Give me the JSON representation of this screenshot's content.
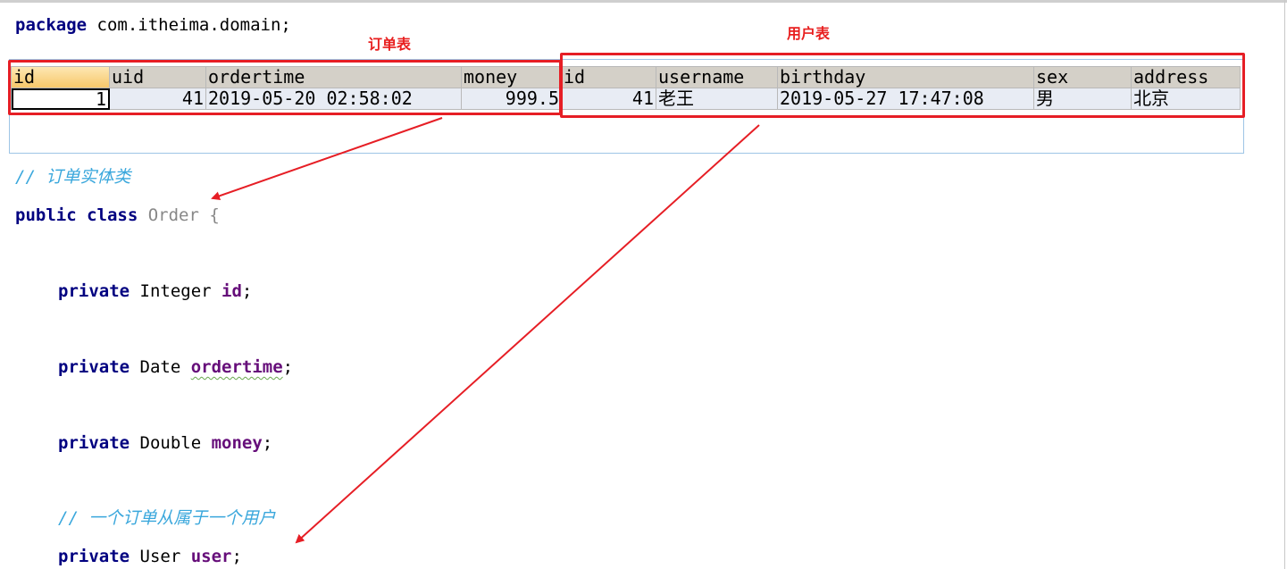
{
  "code": {
    "package_kw": "package",
    "package_name": " com.itheima.domain;",
    "comment_order_class": "// 订单实体类",
    "class_kw": "public class",
    "class_name": "Order",
    "class_brace": " {",
    "fields": [
      {
        "kw": "private",
        "type": " Integer ",
        "name": "id",
        "end": ";"
      },
      {
        "kw": "private",
        "type": " Date ",
        "name": "ordertime",
        "end": ";"
      },
      {
        "kw": "private",
        "type": " Double ",
        "name": "money",
        "end": ";"
      }
    ],
    "comment_user": "// 一个订单从属于一个用户",
    "user_field": {
      "kw": "private",
      "type": " User ",
      "name": "user",
      "end": ";"
    }
  },
  "annotations": {
    "order_table": "订单表",
    "user_table": "用户表"
  },
  "grid": {
    "headers": [
      "id",
      "uid",
      "ordertime",
      "money",
      "id",
      "username",
      "birthday",
      "sex",
      "address"
    ],
    "row": [
      "1",
      "41",
      "2019-05-20 02:58:02",
      "999.5",
      "41",
      "老王",
      "2019-05-27 17:47:08",
      "男",
      "北京"
    ]
  },
  "colors": {
    "keyword": "#000080",
    "field": "#660e7a",
    "comment": "#3aa7dc",
    "annotation_red": "#e61e25",
    "grid_header": "#d4d0c8",
    "grid_cell": "#e8ecf4"
  }
}
